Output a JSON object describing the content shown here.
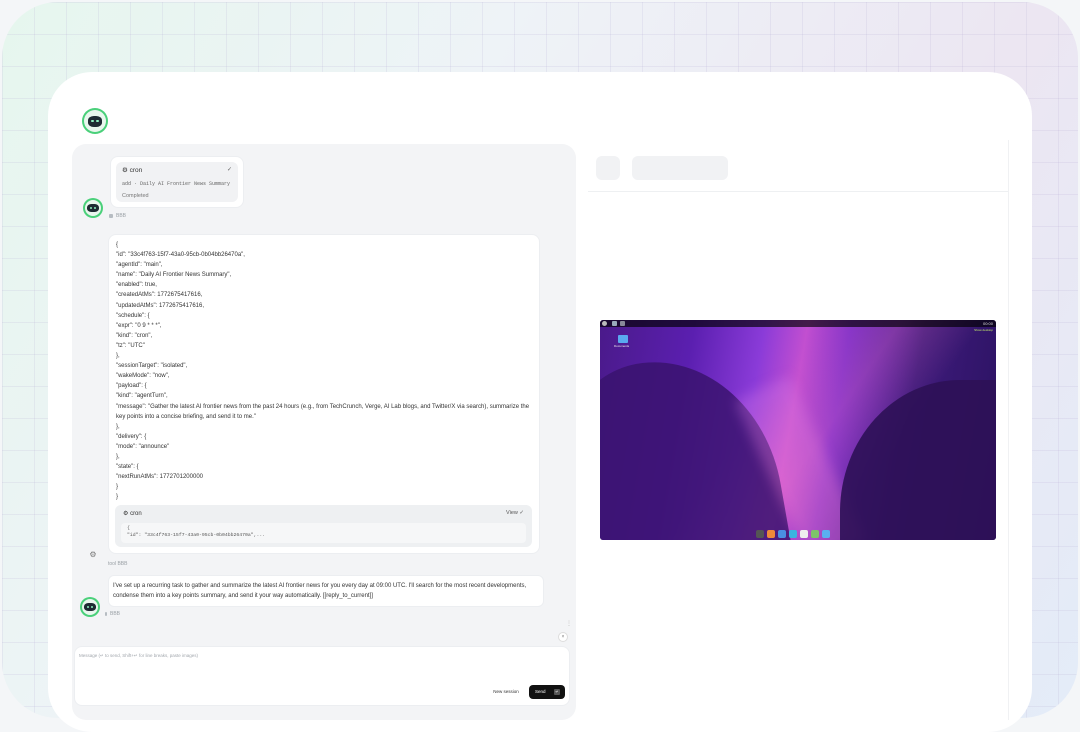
{
  "chat": {
    "tool_call": {
      "name": "cron",
      "summary": "add · Daily AI Frontier News Summary",
      "status": "Completed",
      "meta": "BBB"
    },
    "json_lines": [
      "{",
      "\"id\": \"33c4f763-15f7-43a0-95cb-0b04bb26470a\",",
      "\"agentId\": \"main\",",
      "\"name\": \"Daily AI Frontier News Summary\",",
      "\"enabled\": true,",
      "\"createdAtMs\": 1772675417616,",
      "\"updatedAtMs\": 1772675417616,",
      "\"schedule\": {",
      "\"expr\": \"0 9 * * *\",",
      "\"kind\": \"cron\",",
      "\"tz\": \"UTC\"",
      "},",
      "\"sessionTarget\": \"isolated\",",
      "\"wakeMode\": \"now\",",
      "\"payload\": {",
      "\"kind\": \"agentTurn\",",
      "\"message\": \"Gather the latest AI frontier news from the past 24 hours (e.g., from TechCrunch, Verge, AI Lab blogs, and Twitter/X via search), summarize the key points into a concise briefing, and send it to me.\"",
      "},",
      "\"delivery\": {",
      "\"mode\": \"announce\"",
      "},",
      "\"state\": {",
      "\"nextRunAtMs\": 1772701200000",
      "}",
      "}"
    ],
    "cron_result": {
      "name": "cron",
      "view_label": "View ✓",
      "code_line1": "{",
      "code_line2": "  \"id\": \"33c4f763-15f7-43a0-95cb-0b04bb26470a\",..."
    },
    "tool_meta": "tool  BBB",
    "assistant_message": "I've set up a recurring task to gather and summarize the latest AI frontier news for you every day at 09:00 UTC. I'll search for the most recent developments, condense them into a key points summary, and send it your way automatically. [[reply_to_current]]",
    "assistant_meta": "BBB"
  },
  "composer": {
    "placeholder": "Message (↵ to send, Shift+↵ for line breaks, paste images)",
    "new_session_label": "New session",
    "send_label": "Send"
  },
  "desktop": {
    "folder_label": "Documents",
    "clock": "00:00",
    "note": "Show desktop"
  },
  "colors": {
    "accent_green": "#4ad07a",
    "send_button": "#111111",
    "wallpaper_purple": "#5b1fb0"
  }
}
